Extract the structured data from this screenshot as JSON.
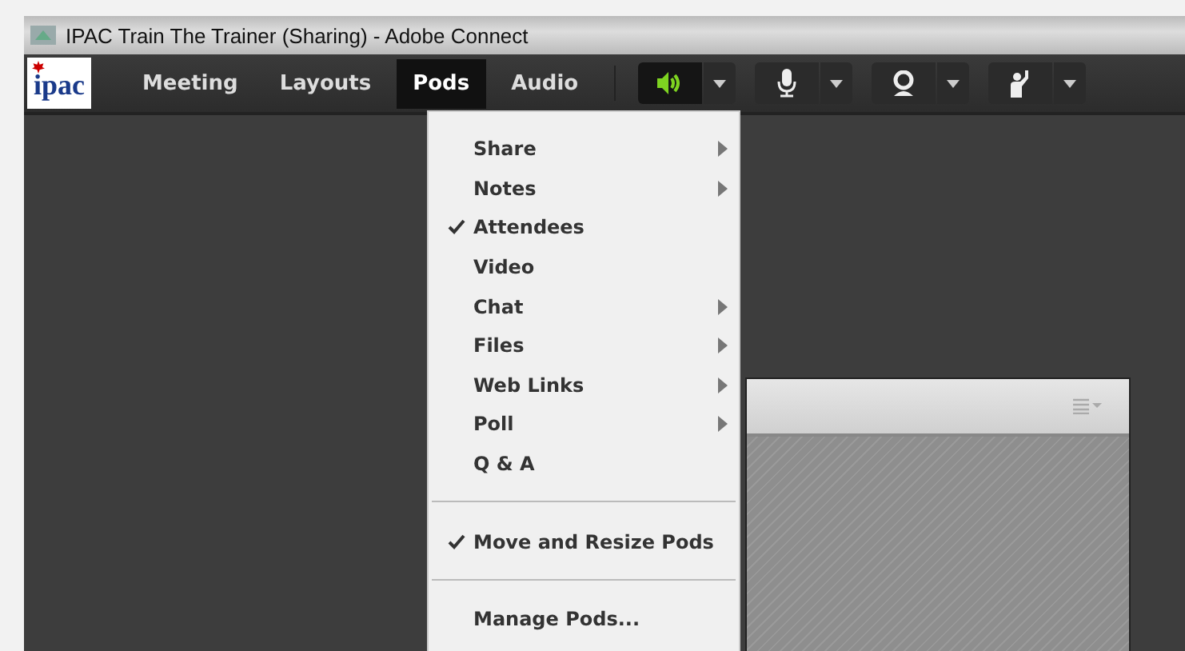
{
  "window": {
    "title": "IPAC Train The Trainer (Sharing) - Adobe Connect"
  },
  "logo": {
    "text": "ipac"
  },
  "menus": [
    {
      "label": "Meeting",
      "selected": false
    },
    {
      "label": "Layouts",
      "selected": false
    },
    {
      "label": "Pods",
      "selected": true
    },
    {
      "label": "Audio",
      "selected": false
    }
  ],
  "devices": [
    {
      "kind": "speaker",
      "on": true
    },
    {
      "kind": "microphone",
      "on": false
    },
    {
      "kind": "camera",
      "on": false
    },
    {
      "kind": "hand",
      "on": false
    }
  ],
  "dropdown": [
    {
      "kind": "item",
      "label": "Share",
      "checked": false,
      "submenu": true
    },
    {
      "kind": "item",
      "label": "Notes",
      "checked": false,
      "submenu": true
    },
    {
      "kind": "item",
      "label": "Attendees",
      "checked": true,
      "submenu": false
    },
    {
      "kind": "item",
      "label": "Video",
      "checked": false,
      "submenu": false
    },
    {
      "kind": "item",
      "label": "Chat",
      "checked": false,
      "submenu": true
    },
    {
      "kind": "item",
      "label": "Files",
      "checked": false,
      "submenu": true
    },
    {
      "kind": "item",
      "label": "Web Links",
      "checked": false,
      "submenu": true
    },
    {
      "kind": "item",
      "label": "Poll",
      "checked": false,
      "submenu": true
    },
    {
      "kind": "item",
      "label": "Q & A",
      "checked": false,
      "submenu": false
    },
    {
      "kind": "separator"
    },
    {
      "kind": "item",
      "label": "Move and Resize Pods",
      "checked": true,
      "submenu": false
    },
    {
      "kind": "separator"
    },
    {
      "kind": "item",
      "label": "Manage Pods...",
      "checked": false,
      "submenu": false
    }
  ]
}
